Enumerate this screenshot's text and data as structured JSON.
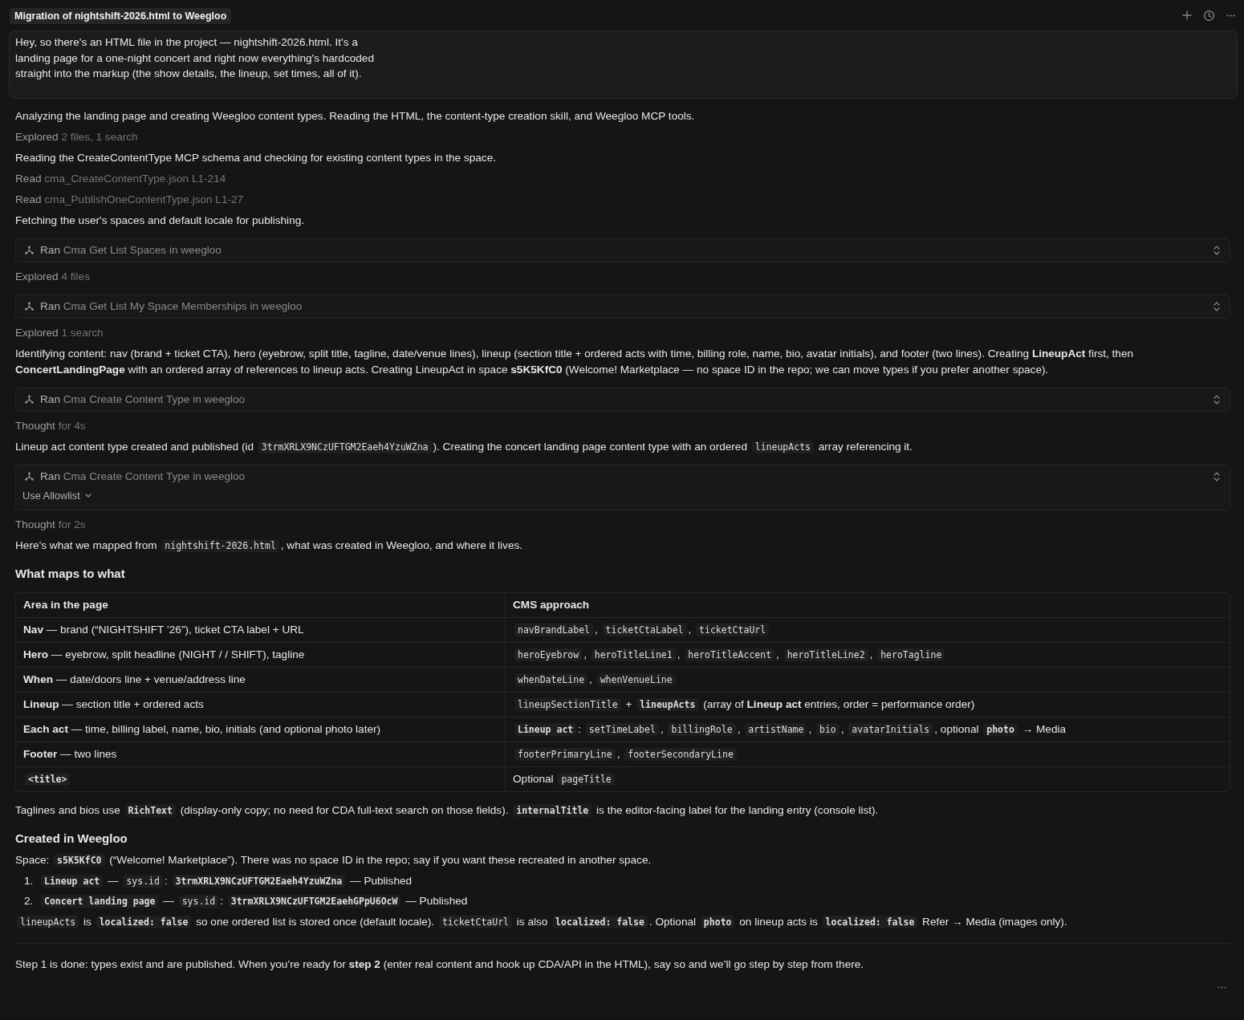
{
  "header": {
    "title": "Migration of nightshift-2026.html to Weegloo"
  },
  "user_message": {
    "lines": [
      "Hey, so there's an HTML file in the project — nightshift-2026.html. It's a",
      "landing page for a one-night concert and right now everything's hardcoded",
      "straight into the markup (the show details, the lineup, set times, all of it)."
    ]
  },
  "transcript": [
    {
      "kind": "text",
      "parts": [
        {
          "kind": "text",
          "text": "Analyzing the landing page and creating Weegloo content types. Reading the HTML, the content-type creation skill, and Weegloo MCP tools."
        }
      ]
    },
    {
      "kind": "status",
      "label": "Explored",
      "detail": "2 files, 1 search"
    },
    {
      "kind": "text",
      "parts": [
        {
          "kind": "text",
          "text": "Reading the CreateContentType MCP schema and checking for existing content types in the space."
        }
      ]
    },
    {
      "kind": "status",
      "label": "Read",
      "detail": "cma_CreateContentType.json L1-214"
    },
    {
      "kind": "status",
      "label": "Read",
      "detail": "cma_PublishOneContentType.json L1-27"
    },
    {
      "kind": "text",
      "parts": [
        {
          "kind": "text",
          "text": "Fetching the user's spaces and default locale for publishing."
        }
      ]
    },
    {
      "kind": "tool",
      "label": "Ran",
      "detail": "Cma Get List Spaces in weegloo"
    },
    {
      "kind": "status",
      "label": "Explored",
      "detail": "4 files"
    },
    {
      "kind": "tool",
      "label": "Ran",
      "detail": "Cma Get List My Space Memberships in weegloo"
    },
    {
      "kind": "status",
      "label": "Explored",
      "detail": "1 search"
    },
    {
      "kind": "text",
      "parts": [
        {
          "kind": "text",
          "text": "Identifying content: nav (brand + ticket CTA), hero (eyebrow, split title, tagline, date/venue lines), lineup (section title + ordered acts with time, billing role, name, bio, avatar initials), and footer (two lines). Creating **LineupAct** first, then **ConcertLandingPage** with an ordered array of references to lineup acts. Creating LineupAct in space **s5K5KfC0** (Welcome! Marketplace — no space ID in the repo; we can move types if you prefer another space)."
        }
      ]
    },
    {
      "kind": "tool",
      "label": "Ran",
      "detail": "Cma Create Content Type in weegloo"
    },
    {
      "kind": "status",
      "label": "Thought",
      "detail": "for 4s"
    },
    {
      "kind": "text",
      "parts": [
        {
          "kind": "text",
          "text": "Lineup act content type created and published (id "
        },
        {
          "kind": "code",
          "text": "3trmXRLX9NCzUFTGM2Eaeh4YzuWZna"
        },
        {
          "kind": "text",
          "text": "). Creating the concert landing page content type with an ordered "
        },
        {
          "kind": "code",
          "text": "lineupActs"
        },
        {
          "kind": "text",
          "text": " array referencing it."
        }
      ]
    },
    {
      "kind": "tool",
      "label": "Ran",
      "detail": "Cma Create Content Type in weegloo",
      "action": "Use Allowlist"
    },
    {
      "kind": "status",
      "label": "Thought",
      "detail": "for 2s"
    },
    {
      "kind": "text",
      "parts": [
        {
          "kind": "text",
          "text": "Here’s what we mapped from "
        },
        {
          "kind": "code",
          "text": "nightshift-2026.html"
        },
        {
          "kind": "text",
          "text": ", what was created in Weegloo, and where it lives."
        }
      ]
    },
    {
      "kind": "heading",
      "text": "What maps to what"
    },
    {
      "kind": "table",
      "columns": [
        "Area in the page",
        "CMS approach"
      ],
      "rows": [
        {
          "cells": [
            [
              {
                "kind": "text",
                "text": "**Nav** — brand (“NIGHTSHIFT ’26”), ticket CTA label + URL"
              }
            ],
            [
              {
                "kind": "code",
                "text": "navBrandLabel"
              },
              {
                "kind": "text",
                "text": ", "
              },
              {
                "kind": "code",
                "text": "ticketCtaLabel"
              },
              {
                "kind": "text",
                "text": ", "
              },
              {
                "kind": "code",
                "text": "ticketCtaUrl"
              }
            ]
          ]
        },
        {
          "cells": [
            [
              {
                "kind": "text",
                "text": "**Hero** — eyebrow, split headline (NIGHT / / SHIFT), tagline"
              }
            ],
            [
              {
                "kind": "code",
                "text": "heroEyebrow"
              },
              {
                "kind": "text",
                "text": ", "
              },
              {
                "kind": "code",
                "text": "heroTitleLine1"
              },
              {
                "kind": "text",
                "text": ", "
              },
              {
                "kind": "code",
                "text": "heroTitleAccent"
              },
              {
                "kind": "text",
                "text": ", "
              },
              {
                "kind": "code",
                "text": "heroTitleLine2"
              },
              {
                "kind": "text",
                "text": ", "
              },
              {
                "kind": "code",
                "text": "heroTagline"
              }
            ]
          ]
        },
        {
          "cells": [
            [
              {
                "kind": "text",
                "text": "**When** — date/doors line + venue/address line"
              }
            ],
            [
              {
                "kind": "code",
                "text": "whenDateLine"
              },
              {
                "kind": "text",
                "text": ", "
              },
              {
                "kind": "code",
                "text": "whenVenueLine"
              }
            ]
          ]
        },
        {
          "cells": [
            [
              {
                "kind": "text",
                "text": "**Lineup** — section title + ordered acts"
              }
            ],
            [
              {
                "kind": "code",
                "text": "lineupSectionTitle"
              },
              {
                "kind": "text",
                "text": " + "
              },
              {
                "kind": "code",
                "text": "**lineupActs**"
              },
              {
                "kind": "text",
                "text": " (array of **Lineup act** entries, order = performance order)"
              }
            ]
          ]
        },
        {
          "cells": [
            [
              {
                "kind": "text",
                "text": "**Each act** — time, billing label, name, bio, initials (and optional photo later)"
              }
            ],
            [
              {
                "kind": "code",
                "text": "**Lineup act**"
              },
              {
                "kind": "text",
                "text": ": "
              },
              {
                "kind": "code",
                "text": "setTimeLabel"
              },
              {
                "kind": "text",
                "text": ", "
              },
              {
                "kind": "code",
                "text": "billingRole"
              },
              {
                "kind": "text",
                "text": ", "
              },
              {
                "kind": "code",
                "text": "artistName"
              },
              {
                "kind": "text",
                "text": ", "
              },
              {
                "kind": "code",
                "text": "bio"
              },
              {
                "kind": "text",
                "text": ", "
              },
              {
                "kind": "code",
                "text": "avatarInitials"
              },
              {
                "kind": "text",
                "text": ", optional "
              },
              {
                "kind": "code",
                "text": "**photo**"
              },
              {
                "kind": "text",
                "text": " → Media"
              }
            ]
          ]
        },
        {
          "cells": [
            [
              {
                "kind": "text",
                "text": "**Footer** — two lines"
              }
            ],
            [
              {
                "kind": "code",
                "text": "footerPrimaryLine"
              },
              {
                "kind": "text",
                "text": ", "
              },
              {
                "kind": "code",
                "text": "footerSecondaryLine"
              }
            ]
          ]
        },
        {
          "cells": [
            [
              {
                "kind": "code",
                "text": "**<title>**"
              }
            ],
            [
              {
                "kind": "text",
                "text": "Optional "
              },
              {
                "kind": "code",
                "text": "pageTitle"
              }
            ]
          ]
        }
      ]
    },
    {
      "kind": "text",
      "parts": [
        {
          "kind": "text",
          "text": "Taglines and bios use "
        },
        {
          "kind": "code",
          "text": "**RichText**"
        },
        {
          "kind": "text",
          "text": " (display-only copy; no need for CDA full-text search on those fields). "
        },
        {
          "kind": "code",
          "text": "**internalTitle**"
        },
        {
          "kind": "text",
          "text": " is the editor-facing label for the landing entry (console list)."
        }
      ]
    },
    {
      "kind": "heading",
      "text": "Created in Weegloo"
    },
    {
      "kind": "text",
      "parts": [
        {
          "kind": "text",
          "text": "Space: "
        },
        {
          "kind": "code",
          "text": "**s5K5KfC0**"
        },
        {
          "kind": "text",
          "text": " (“Welcome! Marketplace”). There was no space ID in the repo; say if you want these recreated in another space."
        }
      ]
    },
    {
      "kind": "list",
      "items": [
        {
          "number": "1.",
          "parts": [
            {
              "kind": "code",
              "text": "**Lineup act**"
            },
            {
              "kind": "text",
              "text": " — "
            },
            {
              "kind": "code",
              "text": "sys.id"
            },
            {
              "kind": "text",
              "text": ": "
            },
            {
              "kind": "code",
              "text": "**3trmXRLX9NCzUFTGM2Eaeh4YzuWZna**"
            },
            {
              "kind": "text",
              "text": " — Published"
            }
          ]
        },
        {
          "number": "2.",
          "parts": [
            {
              "kind": "code",
              "text": "**Concert landing page**"
            },
            {
              "kind": "text",
              "text": " — "
            },
            {
              "kind": "code",
              "text": "sys.id"
            },
            {
              "kind": "text",
              "text": ": "
            },
            {
              "kind": "code",
              "text": "**3trmXRLX9NCzUFTGM2EaehGPpU6OcW**"
            },
            {
              "kind": "text",
              "text": " — Published"
            }
          ]
        }
      ]
    },
    {
      "kind": "text",
      "parts": [
        {
          "kind": "code",
          "text": "lineupActs"
        },
        {
          "kind": "text",
          "text": " is "
        },
        {
          "kind": "code",
          "text": "**localized: false**"
        },
        {
          "kind": "text",
          "text": " so one ordered list is stored once (default locale). "
        },
        {
          "kind": "code",
          "text": "ticketCtaUrl"
        },
        {
          "kind": "text",
          "text": " is also "
        },
        {
          "kind": "code",
          "text": "**localized: false**"
        },
        {
          "kind": "text",
          "text": ". Optional "
        },
        {
          "kind": "code",
          "text": "**photo**"
        },
        {
          "kind": "text",
          "text": " on lineup acts is "
        },
        {
          "kind": "code",
          "text": "**localized: false**"
        },
        {
          "kind": "text",
          "text": " Refer → Media (images only)."
        }
      ]
    },
    {
      "kind": "divider"
    },
    {
      "kind": "text",
      "parts": [
        {
          "kind": "text",
          "text": "Step 1 is done: types exist and are published. When you’re ready for **step 2** (enter real content and hook up CDA/API in the HTML), say so and we’ll go step by step from there."
        }
      ]
    }
  ]
}
